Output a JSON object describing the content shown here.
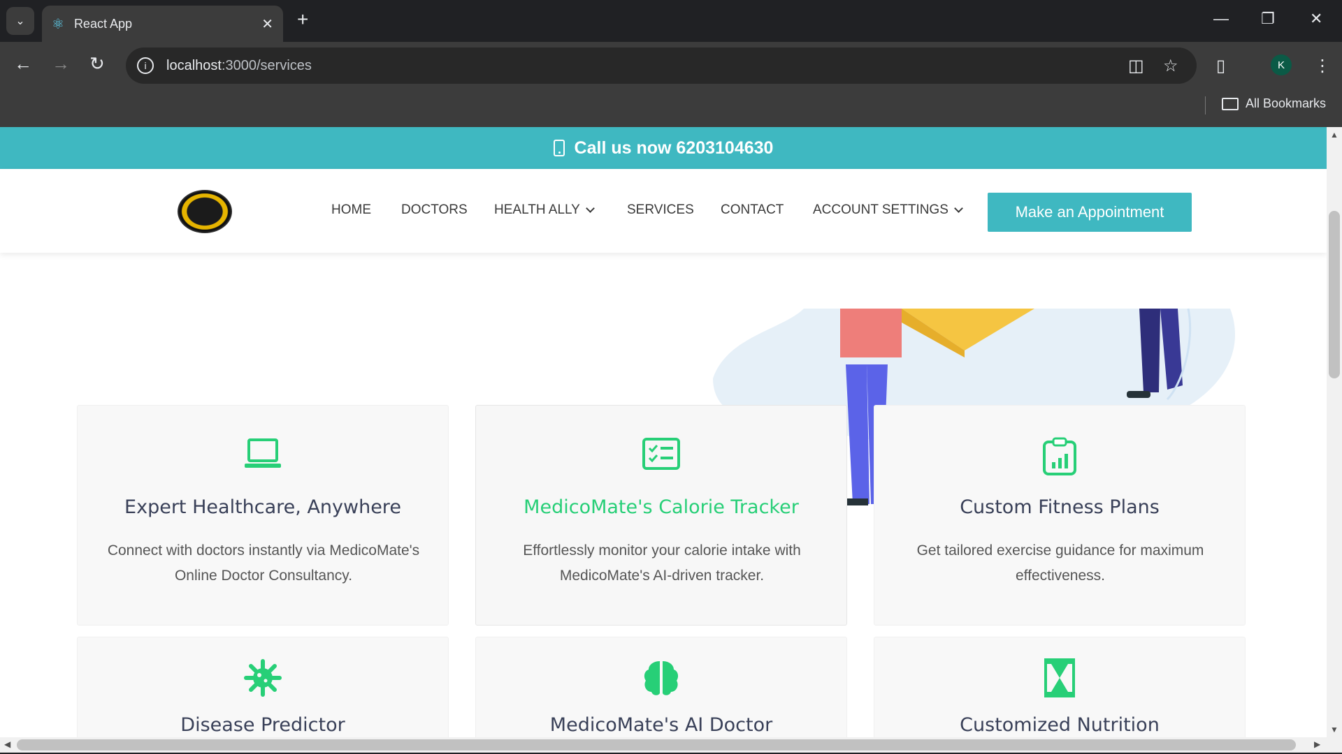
{
  "browser": {
    "tab_title": "React App",
    "url_host": "localhost",
    "url_path": ":3000/services",
    "profile_initial": "K",
    "bookmarks_label": "All Bookmarks"
  },
  "topbar": {
    "call_text": "Call us now 6203104630"
  },
  "nav": {
    "items": [
      "HOME",
      "DOCTORS",
      "HEALTH ALLY",
      "SERVICES",
      "CONTACT",
      "ACCOUNT SETTINGS"
    ],
    "appointment_button": "Make an Appointment"
  },
  "colors": {
    "teal": "#3fb8c1",
    "accent_green": "#27cf77",
    "title_dark": "#394058"
  },
  "services": [
    {
      "icon": "laptop-icon",
      "title": "Expert Healthcare, Anywhere",
      "desc": "Connect with doctors instantly via MedicoMate's Online Doctor Consultancy."
    },
    {
      "icon": "checklist-icon",
      "title": "MedicoMate's Calorie Tracker",
      "desc": "Effortlessly monitor your calorie intake with MedicoMate's AI-driven tracker."
    },
    {
      "icon": "clipboard-chart-icon",
      "title": "Custom Fitness Plans",
      "desc": "Get tailored exercise guidance for maximum effectiveness."
    },
    {
      "icon": "virus-icon",
      "title": "Disease Predictor",
      "desc": ""
    },
    {
      "icon": "brain-icon",
      "title": "MedicoMate's AI Doctor",
      "desc": ""
    },
    {
      "icon": "hourglass-icon",
      "title": "Customized Nutrition",
      "desc": ""
    }
  ]
}
